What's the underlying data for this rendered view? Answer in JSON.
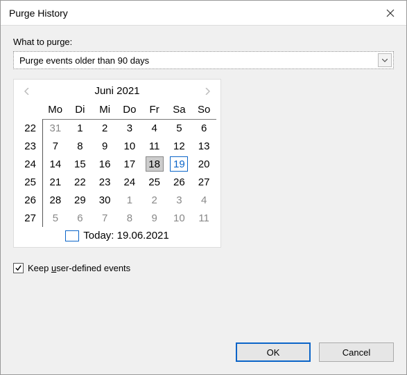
{
  "window": {
    "title": "Purge History"
  },
  "form": {
    "what_label": "What to purge:",
    "dropdown_value": "Purge events older than 90 days",
    "keep_label_pre": "Keep ",
    "keep_label_u": "u",
    "keep_label_post": "ser-defined events"
  },
  "calendar": {
    "month_title": "Juni 2021",
    "weekdays": [
      "Mo",
      "Di",
      "Mi",
      "Do",
      "Fr",
      "Sa",
      "So"
    ],
    "weeks": [
      {
        "wk": "22",
        "days": [
          {
            "n": "31",
            "other": true
          },
          {
            "n": "1"
          },
          {
            "n": "2"
          },
          {
            "n": "3"
          },
          {
            "n": "4"
          },
          {
            "n": "5"
          },
          {
            "n": "6"
          }
        ]
      },
      {
        "wk": "23",
        "days": [
          {
            "n": "7"
          },
          {
            "n": "8"
          },
          {
            "n": "9"
          },
          {
            "n": "10"
          },
          {
            "n": "11"
          },
          {
            "n": "12"
          },
          {
            "n": "13"
          }
        ]
      },
      {
        "wk": "24",
        "days": [
          {
            "n": "14"
          },
          {
            "n": "15"
          },
          {
            "n": "16"
          },
          {
            "n": "17"
          },
          {
            "n": "18",
            "selected": true
          },
          {
            "n": "19",
            "today": true
          },
          {
            "n": "20"
          }
        ]
      },
      {
        "wk": "25",
        "days": [
          {
            "n": "21"
          },
          {
            "n": "22"
          },
          {
            "n": "23"
          },
          {
            "n": "24"
          },
          {
            "n": "25"
          },
          {
            "n": "26"
          },
          {
            "n": "27"
          }
        ]
      },
      {
        "wk": "26",
        "days": [
          {
            "n": "28"
          },
          {
            "n": "29"
          },
          {
            "n": "30"
          },
          {
            "n": "1",
            "other": true
          },
          {
            "n": "2",
            "other": true
          },
          {
            "n": "3",
            "other": true
          },
          {
            "n": "4",
            "other": true
          }
        ]
      },
      {
        "wk": "27",
        "days": [
          {
            "n": "5",
            "other": true
          },
          {
            "n": "6",
            "other": true
          },
          {
            "n": "7",
            "other": true
          },
          {
            "n": "8",
            "other": true
          },
          {
            "n": "9",
            "other": true
          },
          {
            "n": "10",
            "other": true
          },
          {
            "n": "11",
            "other": true
          }
        ]
      }
    ],
    "today_label": "Today: 19.06.2021"
  },
  "buttons": {
    "ok": "OK",
    "cancel": "Cancel"
  }
}
